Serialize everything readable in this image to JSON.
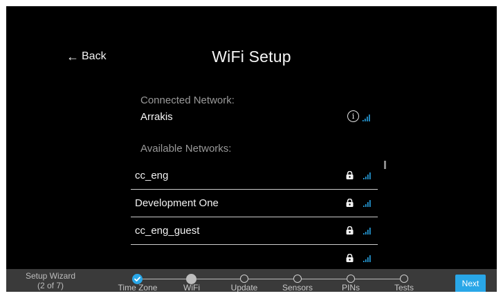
{
  "header": {
    "back_label": "Back",
    "title": "WiFi Setup"
  },
  "connected": {
    "label": "Connected Network:",
    "network": {
      "name": "Arrakis",
      "info_icon": "info-icon",
      "signal_icon": "wifi-signal-icon"
    }
  },
  "available": {
    "label": "Available Networks:",
    "networks": [
      {
        "name": "cc_eng",
        "secured": true
      },
      {
        "name": "Development One",
        "secured": true
      },
      {
        "name": "cc_eng_guest",
        "secured": true
      },
      {
        "name": "",
        "secured": true
      }
    ]
  },
  "footer": {
    "wizard_title": "Setup Wizard",
    "wizard_progress": "(2 of 7)",
    "steps": [
      {
        "label": "Time Zone",
        "state": "done"
      },
      {
        "label": "WiFi",
        "state": "current"
      },
      {
        "label": "Update",
        "state": "pending"
      },
      {
        "label": "Sensors",
        "state": "pending"
      },
      {
        "label": "PINs",
        "state": "pending"
      },
      {
        "label": "Tests",
        "state": "pending"
      }
    ],
    "next_label": "Next"
  },
  "colors": {
    "accent": "#29a7e8",
    "background": "#000000",
    "footer_bg": "#3a3a3a"
  }
}
